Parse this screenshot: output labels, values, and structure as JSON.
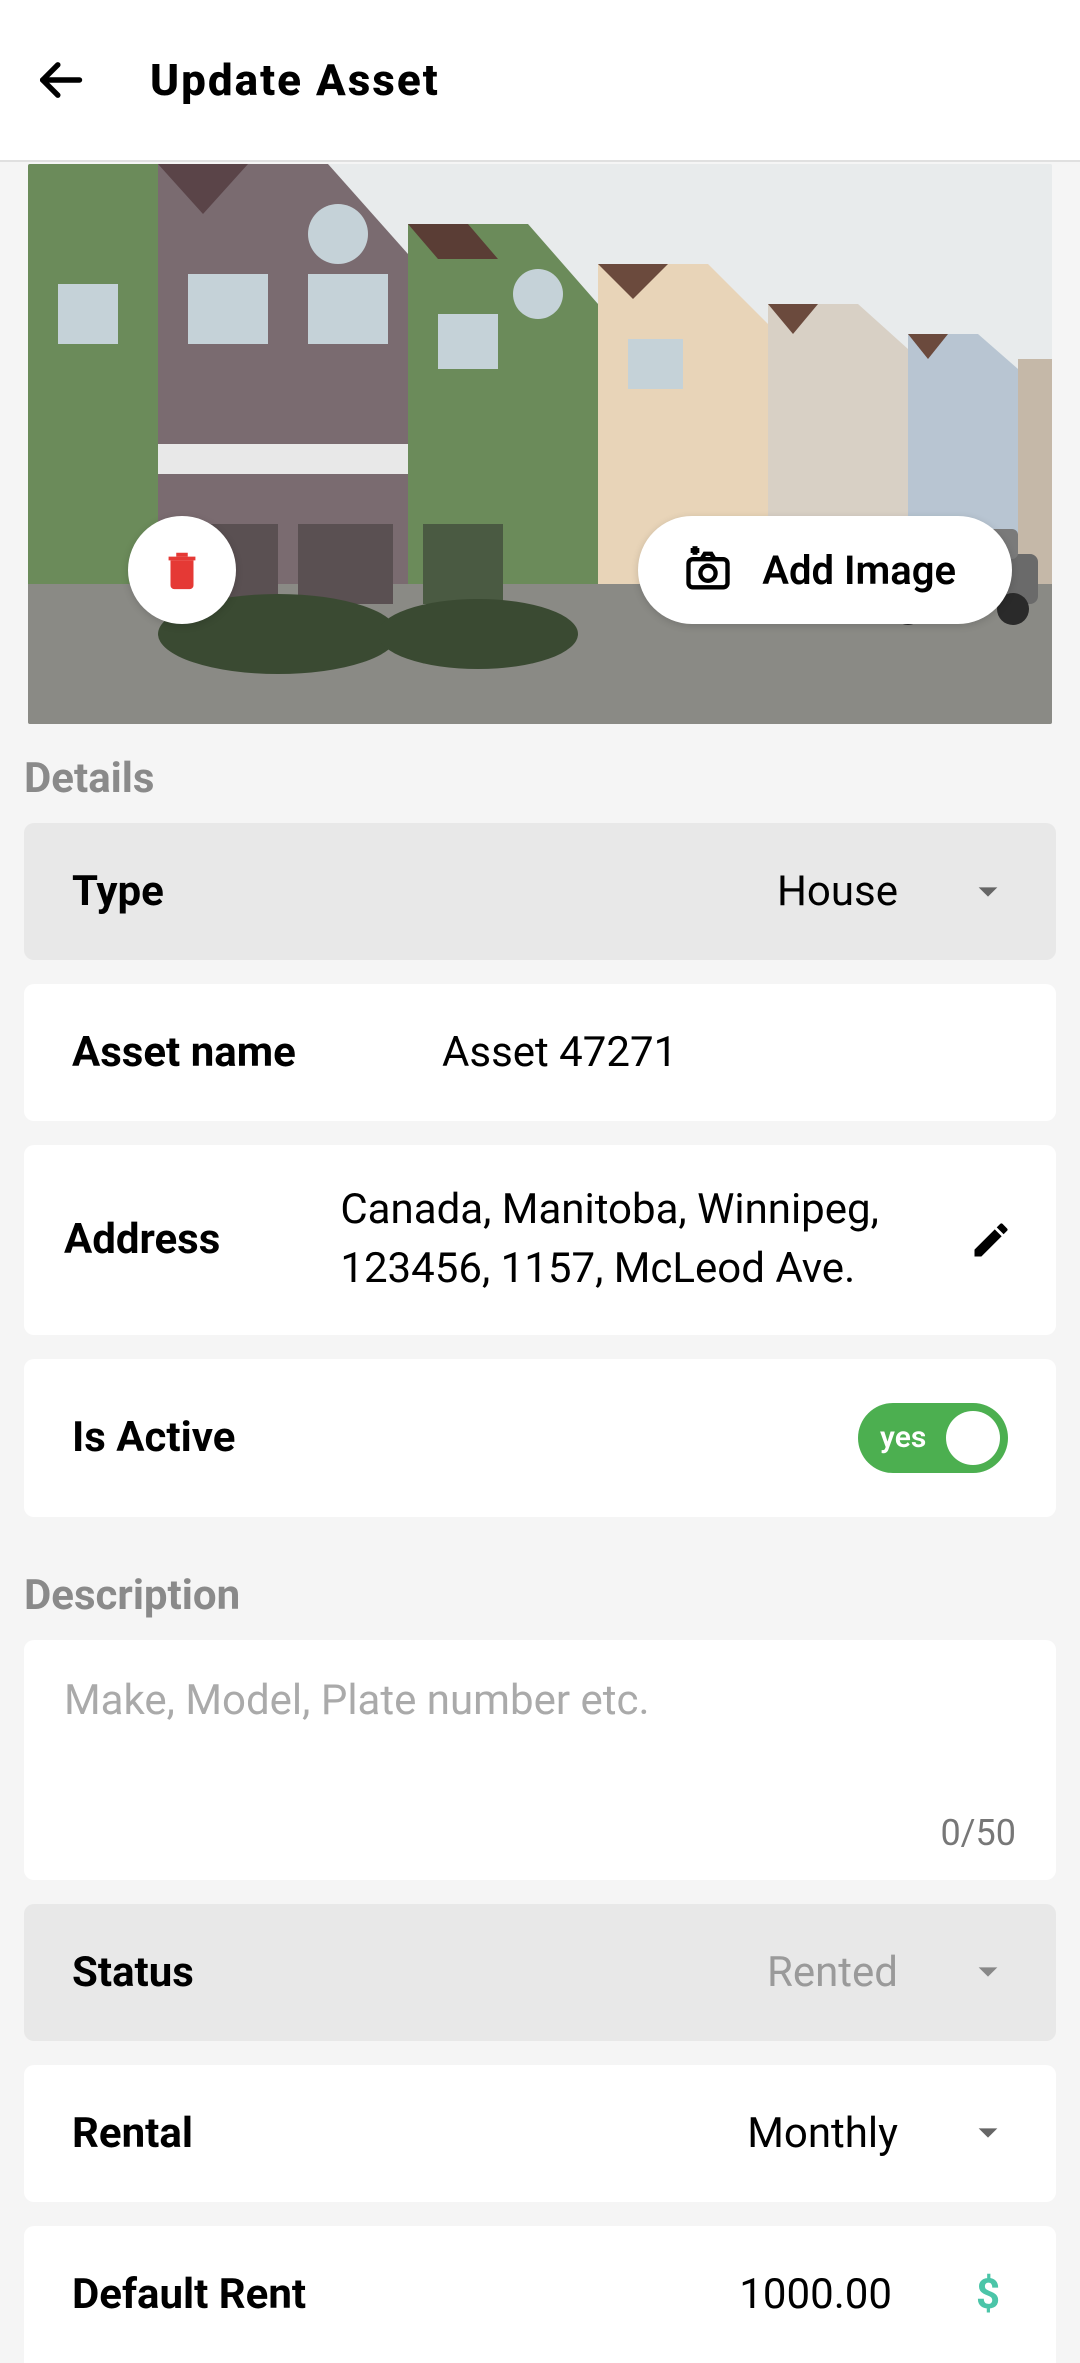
{
  "header": {
    "title": "Update Asset"
  },
  "hero": {
    "add_image_label": "Add Image"
  },
  "sections": {
    "details": "Details",
    "description": "Description"
  },
  "fields": {
    "type": {
      "label": "Type",
      "value": "House"
    },
    "asset_name": {
      "label": "Asset name",
      "value": "Asset 47271"
    },
    "address": {
      "label": "Address",
      "value": "Canada, Manitoba, Winnipeg, 123456, 1157, McLeod Ave."
    },
    "is_active": {
      "label": "Is Active",
      "toggle_text": "yes",
      "toggle_on": true
    },
    "description": {
      "placeholder": "Make, Model, Plate number etc.",
      "counter": "0/50"
    },
    "status": {
      "label": "Status",
      "value": "Rented"
    },
    "rental": {
      "label": "Rental",
      "value": "Monthly"
    },
    "default_rent": {
      "label": "Default Rent",
      "value": "1000.00",
      "currency": "$"
    }
  }
}
